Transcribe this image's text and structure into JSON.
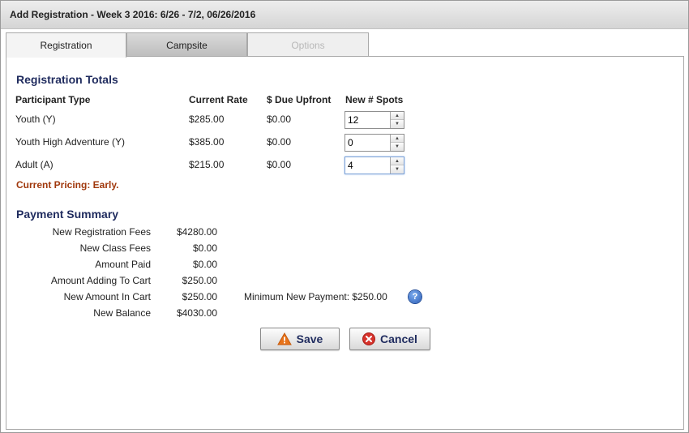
{
  "dialog": {
    "title": "Add Registration - Week 3 2016: 6/26 - 7/2, 06/26/2016"
  },
  "tabs": [
    {
      "label": "Registration",
      "state": "active"
    },
    {
      "label": "Campsite",
      "state": "inactive"
    },
    {
      "label": "Options",
      "state": "disabled"
    }
  ],
  "registration": {
    "title": "Registration Totals",
    "headers": {
      "participant_type": "Participant Type",
      "current_rate": "Current Rate",
      "due_upfront": "$ Due Upfront",
      "new_spots": "New # Spots"
    },
    "rows": [
      {
        "type": "Youth (Y)",
        "rate": "$285.00",
        "due": "$0.00",
        "spots": "12"
      },
      {
        "type": "Youth High Adventure (Y)",
        "rate": "$385.00",
        "due": "$0.00",
        "spots": "0"
      },
      {
        "type": "Adult (A)",
        "rate": "$215.00",
        "due": "$0.00",
        "spots": "4"
      }
    ],
    "pricing_note": "Current Pricing: Early."
  },
  "payment": {
    "title": "Payment Summary",
    "rows": [
      {
        "label": "New Registration Fees",
        "value": "$4280.00"
      },
      {
        "label": "New Class Fees",
        "value": "$0.00"
      },
      {
        "label": "Amount Paid",
        "value": "$0.00"
      },
      {
        "label": "Amount Adding To Cart",
        "value": "$250.00"
      },
      {
        "label": "New Amount In Cart",
        "value": "$250.00"
      },
      {
        "label": "New Balance",
        "value": "$4030.00"
      }
    ],
    "minimum_payment": "Minimum New Payment: $250.00",
    "help_glyph": "?"
  },
  "buttons": {
    "save": "Save",
    "cancel": "Cancel"
  },
  "colors": {
    "section_title": "#1f2b5e",
    "pricing_note": "#a0380c",
    "warn_orange": "#e8731a",
    "cancel_red": "#d6322b",
    "help_blue": "#2a5cb5"
  }
}
